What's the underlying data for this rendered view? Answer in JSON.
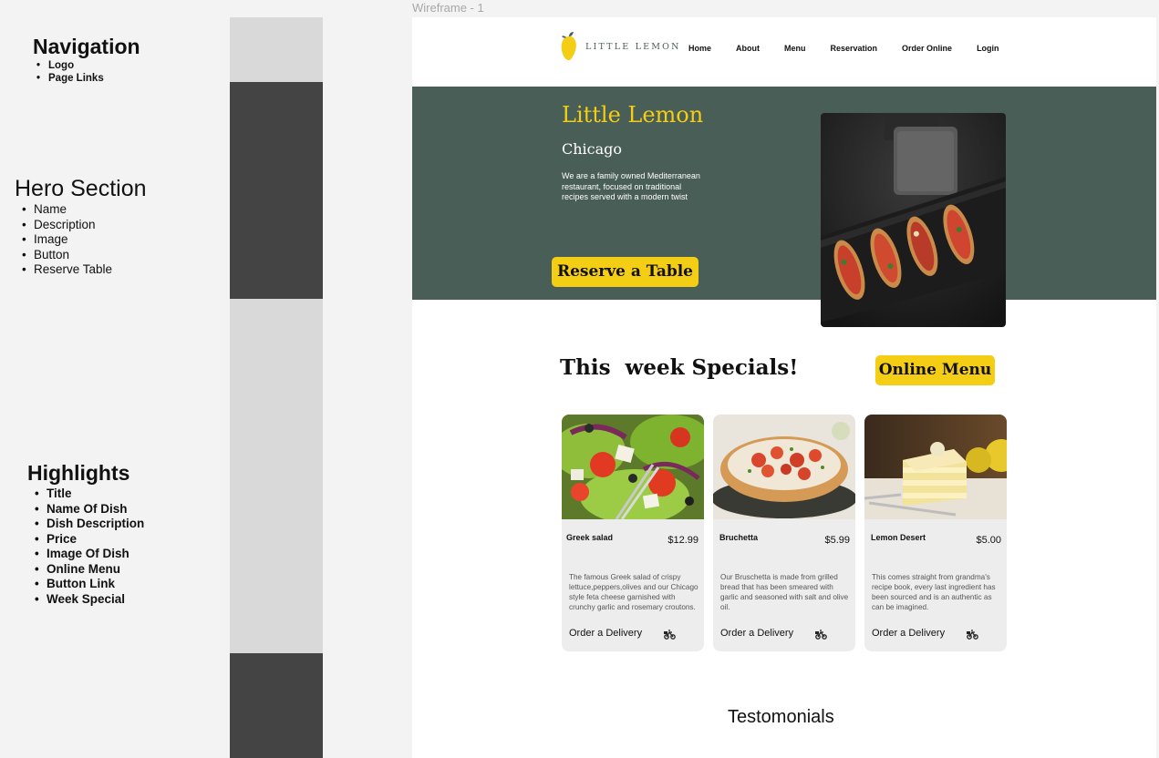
{
  "annotations": {
    "navigation": {
      "title": "Navigation",
      "items": [
        "Logo",
        "Page Links"
      ]
    },
    "hero": {
      "title": "Hero Section",
      "items": [
        "Name",
        "Description",
        "Image",
        "Button",
        "Reserve Table"
      ]
    },
    "highlights": {
      "title": "Highlights",
      "items": [
        "Title",
        "Name Of Dish",
        "Dish Description",
        "Price",
        "Image Of Dish",
        "Online Menu",
        "Button Link",
        "Week Special"
      ]
    }
  },
  "frame_label": "Wireframe - 1",
  "nav": {
    "logo_text": "LITTLE LEMON",
    "links": [
      "Home",
      "About",
      "Menu",
      "Reservation",
      "Order Online",
      "Login"
    ]
  },
  "hero": {
    "title": "Little Lemon",
    "city": "Chicago",
    "description": "We are a family owned Mediterranean restaurant, focused on traditional recipes served with a modern twist",
    "button": "Reserve a Table"
  },
  "specials": {
    "title": "This  week Specials!",
    "menu_button": "Online Menu",
    "cards": [
      {
        "name": "Greek salad",
        "price": "$12.99",
        "description": "The famous Greek salad of crispy lettuce,peppers,olives and our Chicago style feta cheese garnished with crunchy garlic and rosemary croutons.",
        "order": "Order a Delivery"
      },
      {
        "name": "Bruchetta",
        "price": "$5.99",
        "description": "Our Bruschetta is made from grilled bread that has been smeared with garlic and seasoned with salt and olive oil.",
        "order": "Order a Delivery"
      },
      {
        "name": "Lemon Desert",
        "price": "$5.00",
        "description": "This comes straight from grandma's recipe book, every last ingredient has been sourced and is an authentic as can be imagined.",
        "order": "Order a Delivery"
      }
    ]
  },
  "testimonials_title": "Testomonials",
  "colors": {
    "primary_green": "#495e57",
    "primary_yellow": "#f4ce14",
    "bar_light": "#d9d9d9",
    "bar_dark": "#444444"
  }
}
